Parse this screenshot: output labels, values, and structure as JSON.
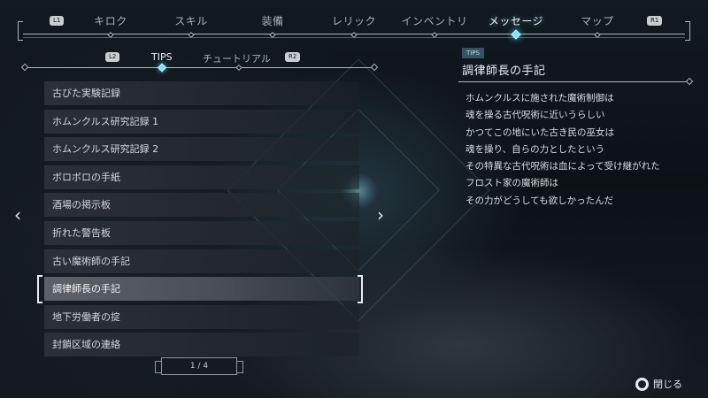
{
  "nav": {
    "left_button": "L1",
    "right_button": "R1",
    "tabs": [
      {
        "label": "キロク"
      },
      {
        "label": "スキル"
      },
      {
        "label": "装備"
      },
      {
        "label": "レリック"
      },
      {
        "label": "インベントリ"
      },
      {
        "label": "メッセージ",
        "active": true
      },
      {
        "label": "マップ"
      }
    ]
  },
  "subtabs": {
    "left_button": "L2",
    "right_button": "R2",
    "items": [
      {
        "label": "TIPS",
        "active": true
      },
      {
        "label": "チュートリアル"
      }
    ]
  },
  "list": {
    "items": [
      {
        "label": "古びた実験記録"
      },
      {
        "label": "ホムンクルス研究記録 1"
      },
      {
        "label": "ホムンクルス研究記録 2"
      },
      {
        "label": "ボロボロの手紙"
      },
      {
        "label": "酒場の掲示板"
      },
      {
        "label": "折れた警告板"
      },
      {
        "label": "古い魔術師の手記"
      },
      {
        "label": "調律師長の手記",
        "selected": true
      },
      {
        "label": "地下労働者の掟"
      },
      {
        "label": "封鎖区域の連絡"
      }
    ],
    "pager": "1 / 4",
    "prev_arrow": "‹",
    "next_arrow": "›"
  },
  "detail": {
    "category": "TIPS",
    "title": "調律師長の手記",
    "lines": [
      "ホムンクルスに施された魔術制御は",
      "魂を操る古代呪術に近いうらしい",
      "かつてこの地にいた古き民の巫女は",
      "魂を操り、自らの力としたという",
      "その特異な古代呪術は血によって受け継がれた",
      "フロスト家の魔術師は",
      "その力がどうしても欲しかったんだ"
    ]
  },
  "footer": {
    "close_icon": "circle-button-icon",
    "close_label": "閉じる"
  },
  "colors": {
    "accent": "#7fe0f5",
    "text": "#d6dbe0",
    "background": "#0b0f13"
  }
}
